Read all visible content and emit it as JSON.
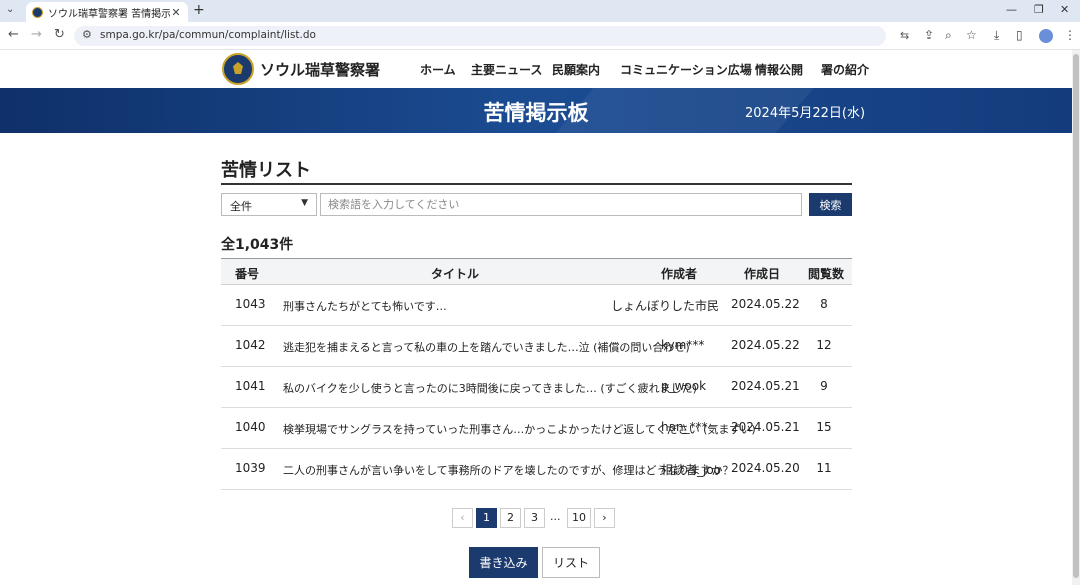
{
  "browser": {
    "tab_title": "ソウル瑞草警察署 苦情掲示板",
    "url": "smpa.go.kr/pa/commun/complaint/list.do"
  },
  "site": {
    "logo_text": "ソウル瑞草警察署",
    "nav": [
      "ホーム",
      "主要ニュース",
      "民願案内",
      "コミュニケーション広場",
      "情報公開",
      "署の紹介"
    ]
  },
  "banner": {
    "title": "苦情掲示板",
    "date": "2024年5月22日(水)"
  },
  "board": {
    "heading": "苦情リスト",
    "filter_selected": "全件",
    "search_placeholder": "検索語を入力してください",
    "search_button": "検索",
    "total": "全1,043件",
    "columns": {
      "no": "番号",
      "title": "タイトル",
      "author": "作成者",
      "date": "作成日",
      "views": "閲覧数"
    },
    "rows": [
      {
        "no": "1043",
        "title": "刑事さんたちがとても怖いです…",
        "author": "しょんぼりした市民",
        "date": "2024.05.22",
        "views": "8"
      },
      {
        "no": "1042",
        "title": "逃走犯を捕まえると言って私の車の上を踏んでいきました…泣 (補償の問い合わせ)",
        "author": "kym***",
        "date": "2024.05.22",
        "views": "12"
      },
      {
        "no": "1041",
        "title": "私のバイクを少し使うと言ったのに3時間後に戻ってきました… (すごく疲れました)",
        "author": "p_wook",
        "date": "2024.05.21",
        "views": "9"
      },
      {
        "no": "1040",
        "title": "検挙現場でサングラスを持っていった刑事さん…かっこよかったけど返してください (気まずい)",
        "author": "han_***",
        "date": "2024.05.21",
        "views": "15"
      },
      {
        "no": "1039",
        "title": "二人の刑事さんが言い争いをして事務所のドアを壊したのですが、修理はどうなりますか？",
        "author": "相談者_joo",
        "date": "2024.05.20",
        "views": "11"
      }
    ]
  },
  "pagination": {
    "prev": "‹",
    "pages": [
      "1",
      "2",
      "3"
    ],
    "ellipsis": "...",
    "last": "10",
    "next": "›",
    "current": "1"
  },
  "actions": {
    "write": "書き込み",
    "list": "リスト"
  },
  "icons": [
    "search-icon",
    "share-icon",
    "zoom-icon",
    "star-icon",
    "download-icon",
    "sidepanel-icon",
    "profile-icon",
    "menu-icon"
  ],
  "colors": {
    "primary": "#1b3a6e",
    "banner": "#1b4c92"
  }
}
